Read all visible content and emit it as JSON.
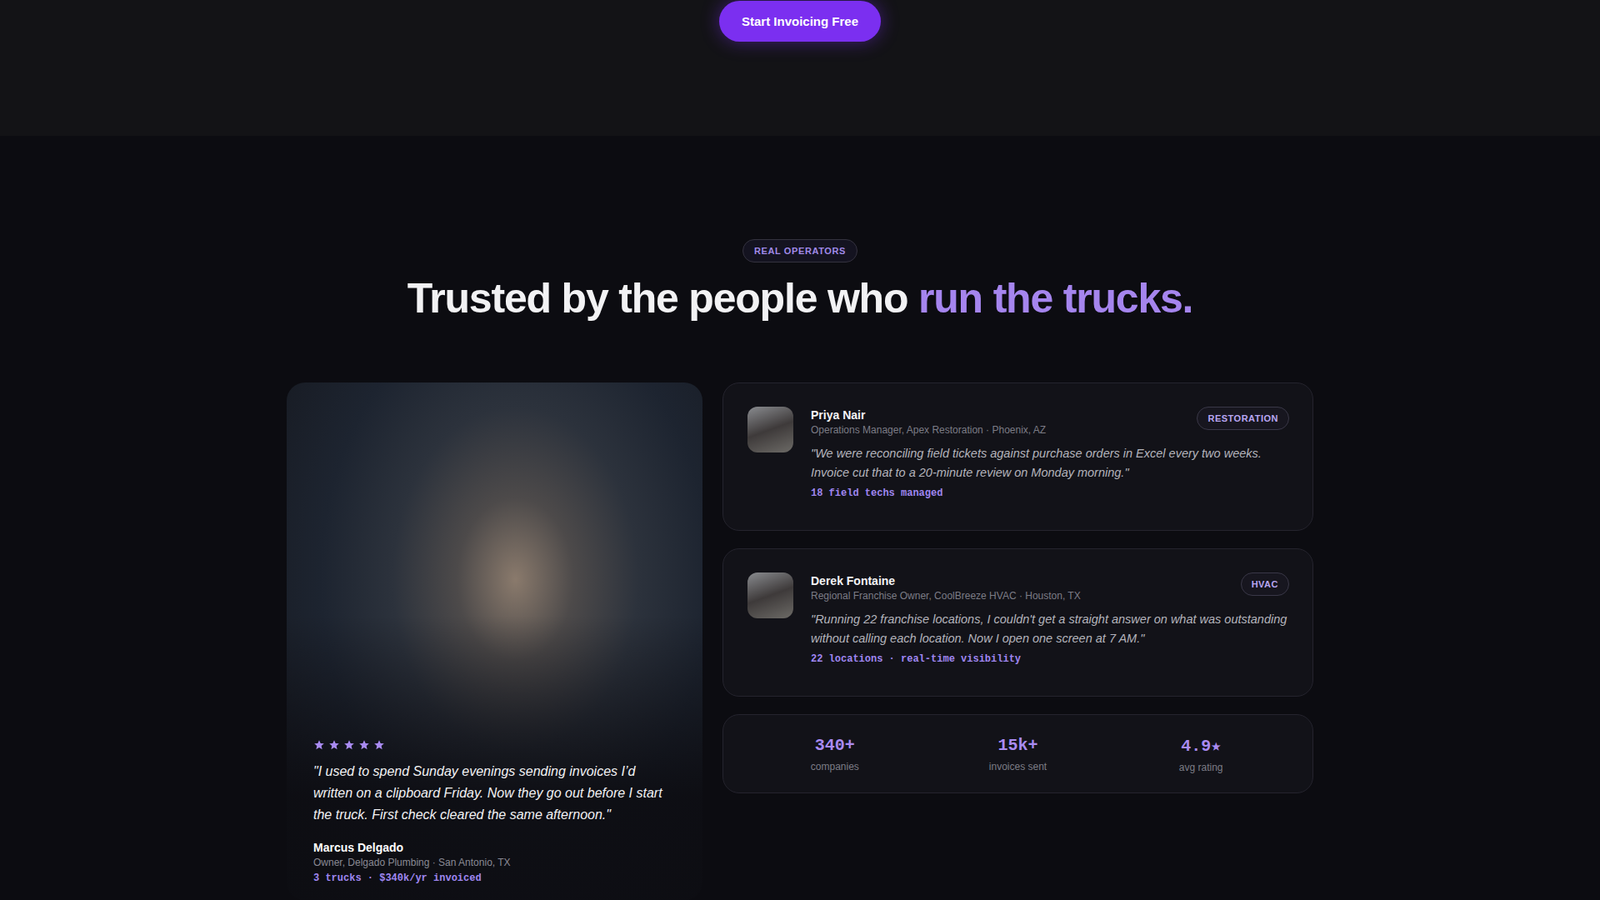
{
  "cta": {
    "label": "Start Invoicing Free"
  },
  "section": {
    "badge": "REAL OPERATORS",
    "heading": "Trusted by the people who",
    "heading_accent": "run the trucks."
  },
  "featured": {
    "stars": 5,
    "quote": "\"I used to spend Sunday evenings sending invoices I’d written on a clipboard Friday. Now they go out before I start the truck. First check cleared the same afternoon.\"",
    "name": "Marcus Delgado",
    "role": "Owner, Delgado Plumbing · San Antonio, TX",
    "metric": "3 trucks · $340k/yr invoiced"
  },
  "testimonials": [
    {
      "name": "Priya Nair",
      "role": "Operations Manager, Apex Restoration · Phoenix, AZ",
      "tag": "RESTORATION",
      "quote": "\"We were reconciling field tickets against purchase orders in Excel every two weeks. Invoice cut that to a 20-minute review on Monday morning.\"",
      "metric": "18 field techs managed"
    },
    {
      "name": "Derek Fontaine",
      "role": "Regional Franchise Owner, CoolBreeze HVAC · Houston, TX",
      "tag": "HVAC",
      "quote": "\"Running 22 franchise locations, I couldn't get a straight answer on what was outstanding without calling each location. Now I open one screen at 7 AM.\"",
      "metric": "22 locations · real-time visibility"
    }
  ],
  "stats": [
    {
      "value": "340+",
      "label": "companies"
    },
    {
      "value": "15k+",
      "label": "invoices sent"
    },
    {
      "value": "4.9★",
      "label": "avg rating"
    }
  ]
}
